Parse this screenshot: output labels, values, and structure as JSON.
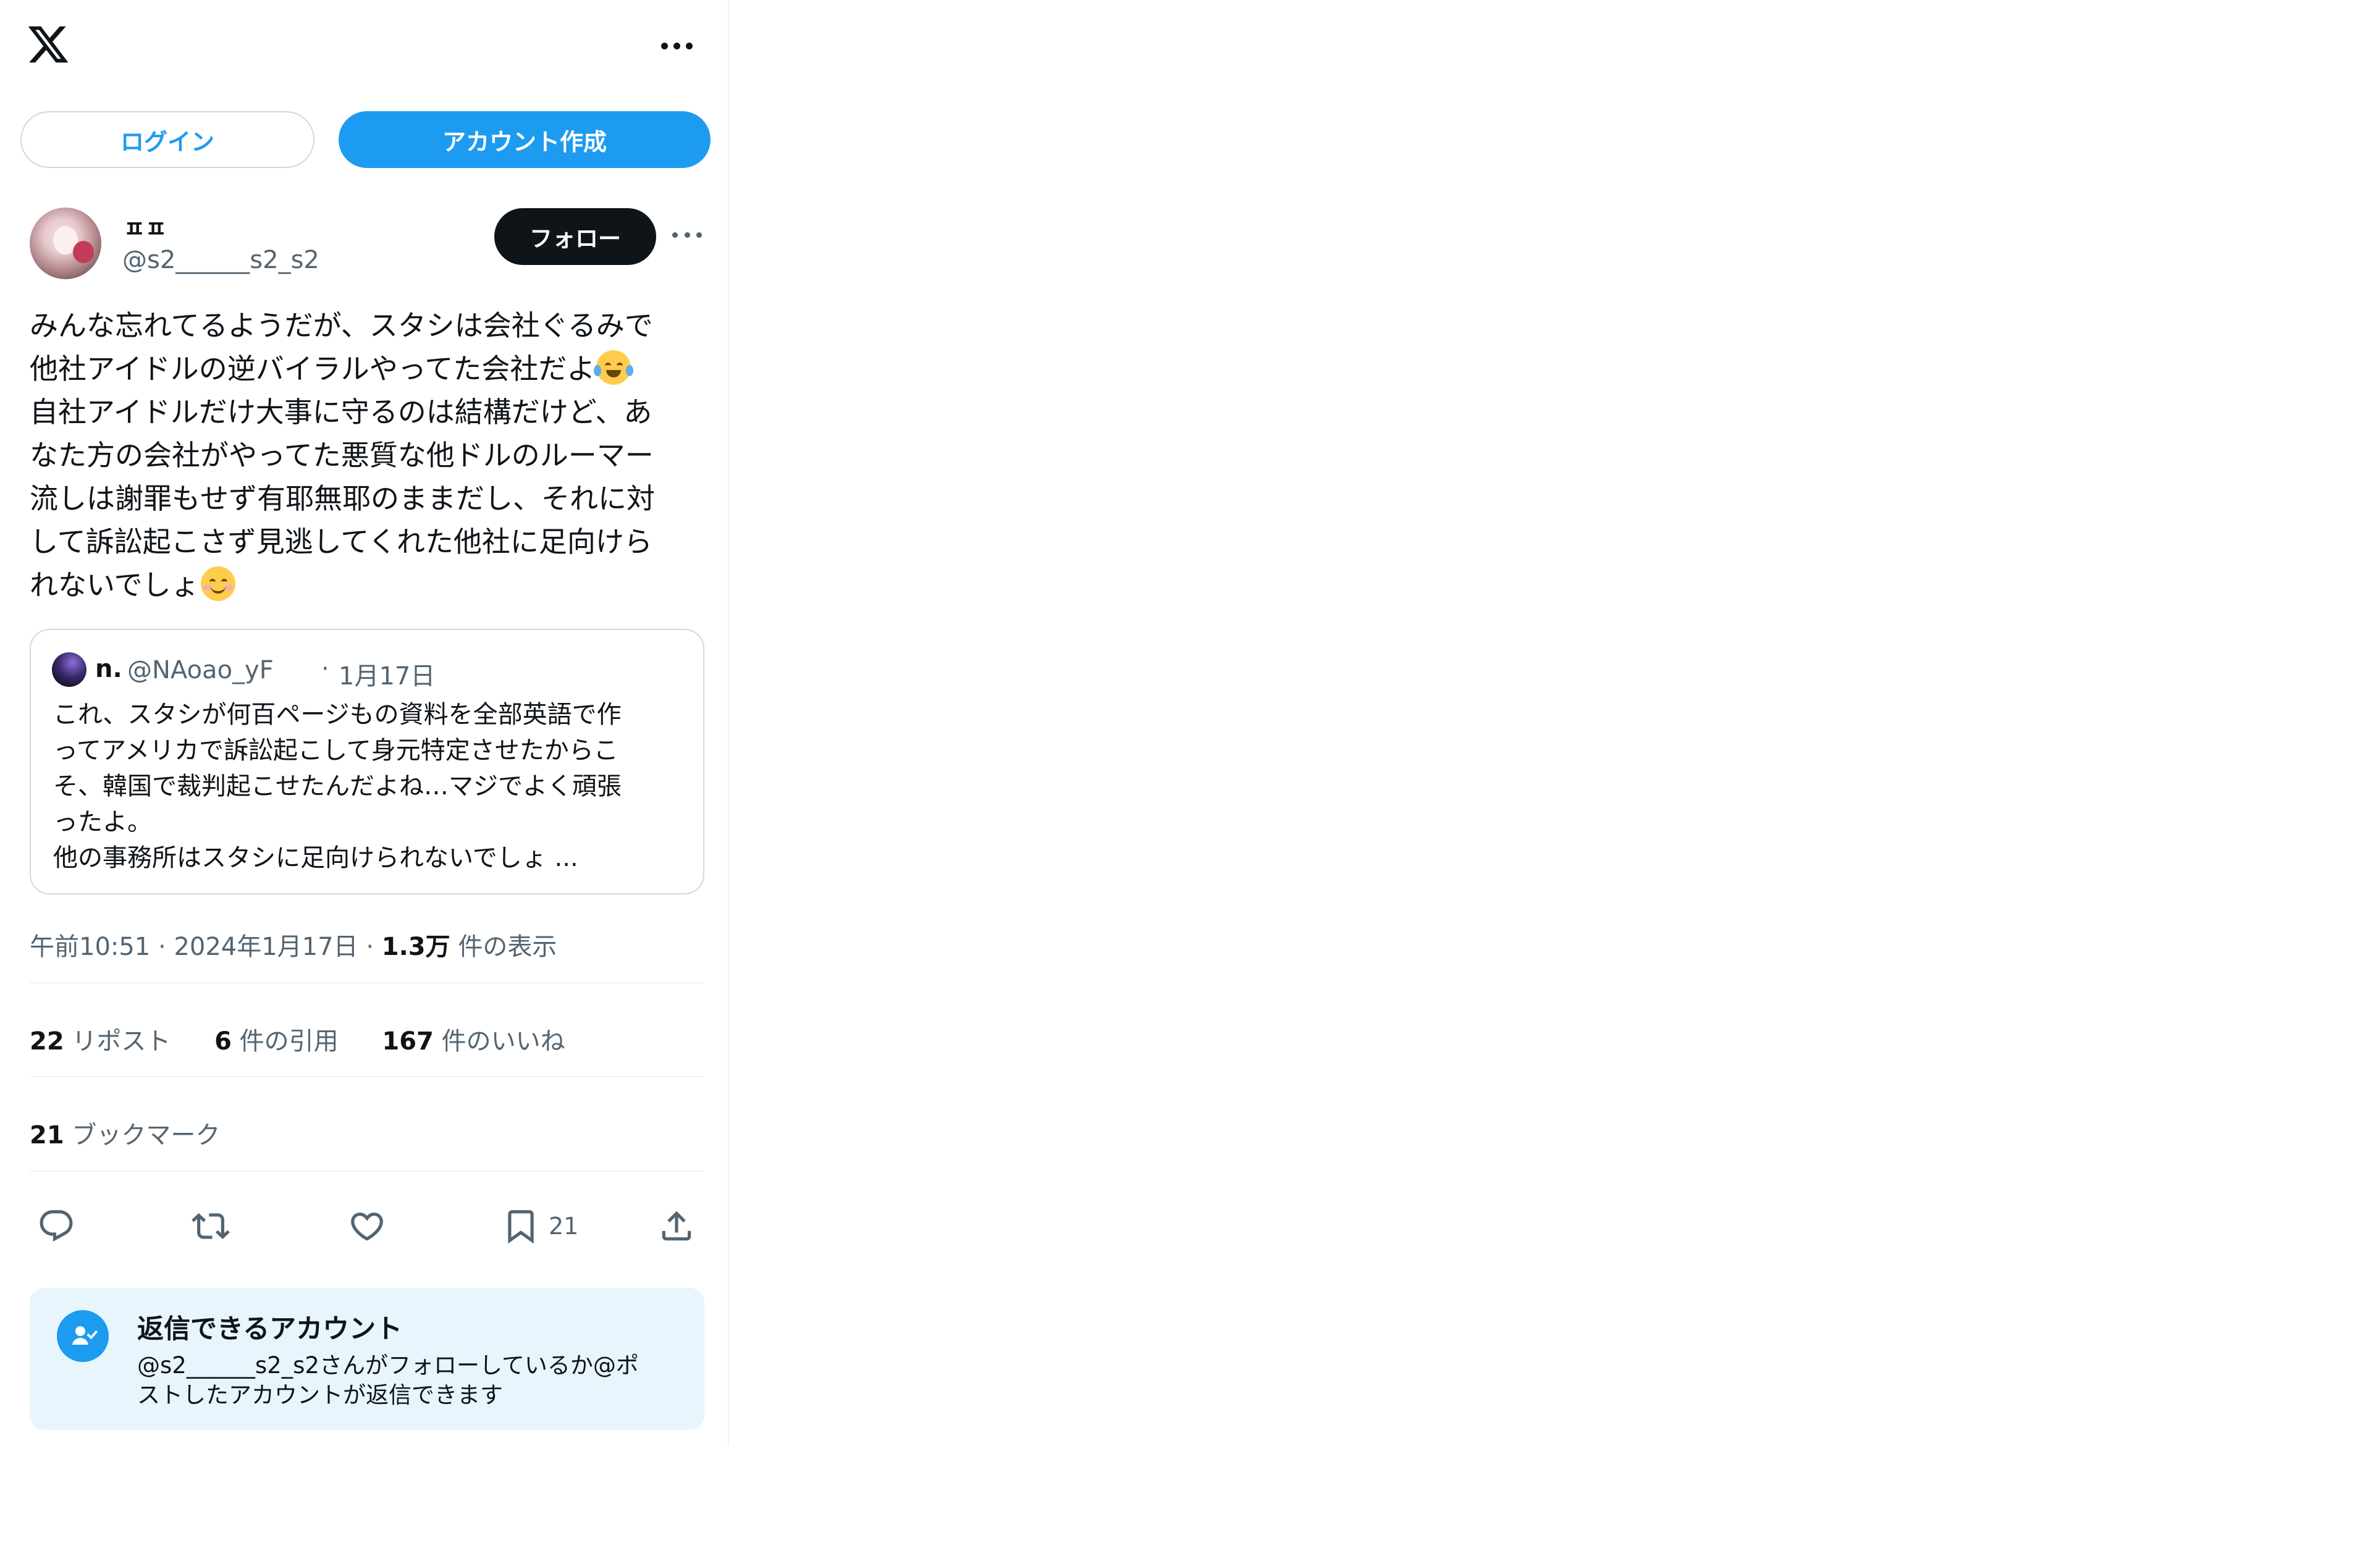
{
  "header": {
    "logo_icon": "x-logo-icon",
    "more_icon": "more-horizontal-icon",
    "login_label": "ログイン",
    "signup_label": "アカウント作成"
  },
  "post": {
    "author": {
      "display_name": "ㅍㅍ",
      "handle": "@s2______s2_s2"
    },
    "follow_label": "フォロー",
    "text_lines": [
      "みんな忘れてるようだが、スタシは会社ぐるみで",
      "他社アイドルの逆バイラルやってた会社だよ",
      "自社アイドルだけ大事に守るのは結構だけど、あ",
      "なた方の会社がやってた悪質な他ドルのルーマー",
      "流しは謝罪もせず有耶無耶のままだし、それに対",
      "して訴訟起こさず見逃してくれた他社に足向けら",
      "れないでしょ"
    ],
    "emojis": [
      "face-with-tears-of-joy",
      "smiling-face"
    ],
    "quote": {
      "name": "n.",
      "handle": "@NAoao_yF",
      "separator": "·",
      "date": "1月17日",
      "text_lines": [
        "これ、スタシが何百ページもの資料を全部英語で作",
        "ってアメリカで訴訟起こして身元特定させたからこ",
        "そ、韓国で裁判起こせたんだよね…マジでよく頑張",
        "ったよ。",
        "他の事務所はスタシに足向けられないでしょ ..."
      ]
    },
    "meta": {
      "time": "午前10:51",
      "date": "2024年1月17日",
      "views_count": "1.3万",
      "views_label": "件の表示",
      "sep": "·"
    },
    "stats": {
      "reposts_count": "22",
      "reposts_label": "リポスト",
      "quotes_count": "6",
      "quotes_label": "件の引用",
      "likes_count": "167",
      "likes_label": "件のいいね",
      "bookmarks_count": "21",
      "bookmarks_label": "ブックマーク"
    },
    "actions": {
      "reply_icon": "reply-icon",
      "repost_icon": "repost-icon",
      "like_icon": "like-icon",
      "bookmark_icon": "bookmark-icon",
      "bookmark_count": "21",
      "share_icon": "share-icon"
    }
  },
  "reply_info": {
    "icon": "user-check-icon",
    "title": "返信できるアカウント",
    "desc_lines": [
      "@s2______s2_s2さんがフォローしているか@ポ",
      "ストしたアカウントが返信できます"
    ]
  },
  "colors": {
    "accent": "#1d9bf0",
    "text": "#0f1419",
    "secondary": "#536471",
    "border": "#cfd9de",
    "reply_bg": "#e8f5fd"
  }
}
